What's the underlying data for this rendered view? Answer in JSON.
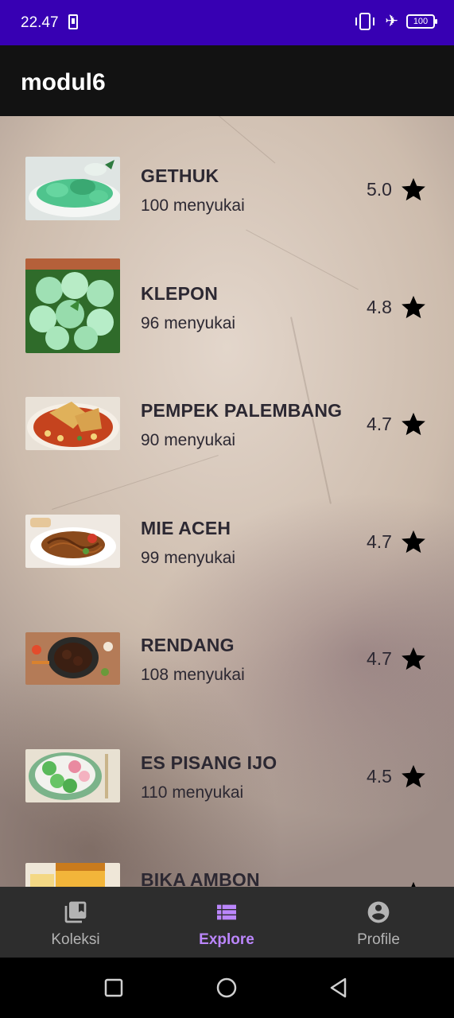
{
  "status_bar": {
    "time": "22.47",
    "battery": "100"
  },
  "app_bar": {
    "title": "modul6"
  },
  "foods": [
    {
      "name": "GETHUK",
      "likes": "100 menyukai",
      "rating": "5.0"
    },
    {
      "name": "KLEPON",
      "likes": "96 menyukai",
      "rating": "4.8"
    },
    {
      "name": "PEMPEK PALEMBANG",
      "likes": "90 menyukai",
      "rating": "4.7"
    },
    {
      "name": "MIE ACEH",
      "likes": "99 menyukai",
      "rating": "4.7"
    },
    {
      "name": "RENDANG",
      "likes": "108 menyukai",
      "rating": "4.7"
    },
    {
      "name": "ES PISANG IJO",
      "likes": "110 menyukai",
      "rating": "4.5"
    },
    {
      "name": "BIKA AMBON",
      "likes": "",
      "rating": ""
    }
  ],
  "bottom_nav": {
    "items": [
      {
        "label": "Koleksi",
        "icon": "library-icon"
      },
      {
        "label": "Explore",
        "icon": "list-icon"
      },
      {
        "label": "Profile",
        "icon": "account-circle-icon"
      }
    ],
    "active_index": 1,
    "active_color": "#bb86fc",
    "inactive_color": "#b3b3b3"
  },
  "colors": {
    "status_bar": "#3700b3",
    "app_bar": "#121212",
    "nav_bar": "#2d2d2d"
  }
}
